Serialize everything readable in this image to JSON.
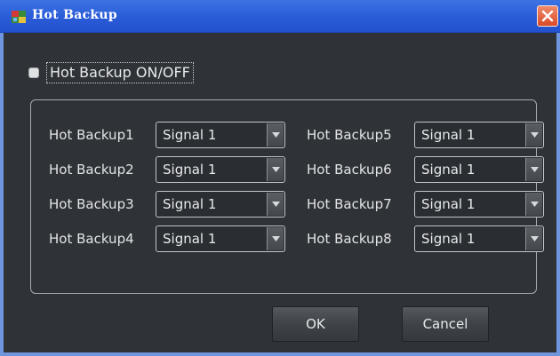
{
  "window": {
    "title": "Hot Backup",
    "icon": "app-icon",
    "close_icon": "close-icon"
  },
  "toggle": {
    "label": "Hot Backup ON/OFF",
    "checked": false
  },
  "backups": [
    {
      "label": "Hot Backup1",
      "value": "Signal 1"
    },
    {
      "label": "Hot Backup2",
      "value": "Signal 1"
    },
    {
      "label": "Hot Backup3",
      "value": "Signal 1"
    },
    {
      "label": "Hot Backup4",
      "value": "Signal 1"
    },
    {
      "label": "Hot Backup5",
      "value": "Signal 1"
    },
    {
      "label": "Hot Backup6",
      "value": "Signal 1"
    },
    {
      "label": "Hot Backup7",
      "value": "Signal 1"
    },
    {
      "label": "Hot Backup8",
      "value": "Signal 1"
    }
  ],
  "buttons": {
    "ok": "OK",
    "cancel": "Cancel"
  },
  "colors": {
    "titlebar": "#2a5bd7",
    "dialog_bg": "#2f3236",
    "close_button": "#d94a26",
    "text": "#e8eaec"
  }
}
